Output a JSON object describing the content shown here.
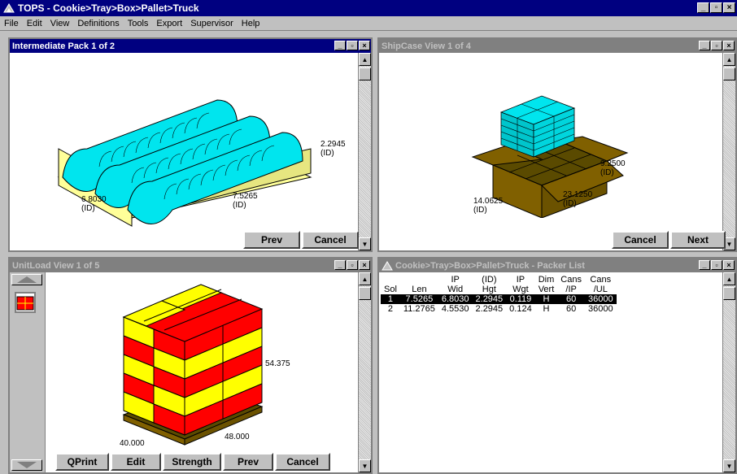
{
  "window": {
    "title": "TOPS - Cookie>Tray>Box>Pallet>Truck"
  },
  "menu": [
    "File",
    "Edit",
    "View",
    "Definitions",
    "Tools",
    "Export",
    "Supervisor",
    "Help"
  ],
  "title_buttons": {
    "minimize": "_",
    "restore": "▫",
    "close": "×"
  },
  "pane_tl": {
    "title": "Intermediate Pack  1 of 2",
    "dim_height": "2.2945",
    "dim_height_unit": "(ID)",
    "dim_width": "6.8030",
    "dim_width_unit": "(ID)",
    "dim_length": "7.5265",
    "dim_length_unit": "(ID)",
    "buttons": {
      "prev": "Prev",
      "cancel": "Cancel"
    }
  },
  "pane_tr": {
    "title": "ShipCase View  1 of 4",
    "dim_height": "9.2500",
    "dim_height_unit": "(ID)",
    "dim_width": "14.0625",
    "dim_width_unit": "(ID)",
    "dim_length": "23.1250",
    "dim_length_unit": "(ID)",
    "buttons": {
      "cancel": "Cancel",
      "next": "Next"
    }
  },
  "pane_bl": {
    "title": "UnitLoad View  1 of 5",
    "dim_height": "54.375",
    "dim_width": "40.000",
    "dim_length": "48.000",
    "buttons": {
      "qprint": "QPrint",
      "edit": "Edit",
      "strength": "Strength",
      "prev": "Prev",
      "cancel": "Cancel"
    }
  },
  "pane_br": {
    "title": "Cookie>Tray>Box>Pallet>Truck - Packer List",
    "header_row1": [
      "",
      "",
      "IP",
      "(ID)",
      "IP",
      "Dim",
      "Cans",
      "Cans"
    ],
    "header_row2": [
      "Sol",
      "Len",
      "Wid",
      "Hgt",
      "Wgt",
      "Vert",
      "/IP",
      "/UL"
    ],
    "rows": [
      [
        "1",
        "7.5265",
        "6.8030",
        "2.2945",
        "0.119",
        "H",
        "60",
        "36000"
      ],
      [
        "2",
        "11.2765",
        "4.5530",
        "2.2945",
        "0.124",
        "H",
        "60",
        "36000"
      ]
    ]
  },
  "colors": {
    "titlebar_active": "#000080",
    "titlebar_inactive": "#808080",
    "cookie": "#00e5ee",
    "tray": "#ffff99",
    "box": "#806000",
    "load_red": "#ff0000",
    "load_yellow": "#ffff00"
  }
}
